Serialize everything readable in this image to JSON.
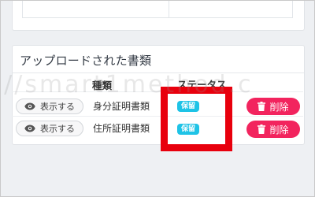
{
  "documents_section": {
    "title": "アップロードされた書類",
    "columns": {
      "kind": "種類",
      "status": "ステータス"
    },
    "rows": [
      {
        "view_label": "表示する",
        "document_name": "身分証明書類",
        "status": "保留",
        "delete_label": "削除"
      },
      {
        "view_label": "表示する",
        "document_name": "住所証明書類",
        "status": "保留",
        "delete_label": "削除"
      }
    ]
  },
  "watermark": "://smart1method.c",
  "colors": {
    "status_badge": "#1ec3e6",
    "delete_button": "#f2245e",
    "highlight": "#e8000d"
  }
}
